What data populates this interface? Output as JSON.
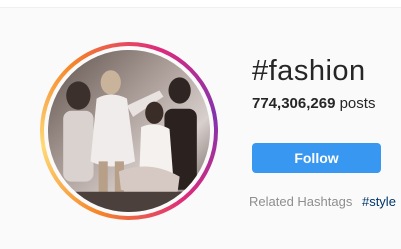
{
  "hashtag": {
    "title": "#fashion",
    "post_count": "774,306,269",
    "post_label": "posts"
  },
  "actions": {
    "follow_label": "Follow"
  },
  "related": {
    "label": "Related Hashtags",
    "tags": [
      "#style"
    ]
  },
  "colors": {
    "follow_button": "#3897f0",
    "related_tag": "#003569",
    "muted_text": "#8e8e8e"
  },
  "avatar": {
    "icon": "hashtag-top-post-photo"
  }
}
